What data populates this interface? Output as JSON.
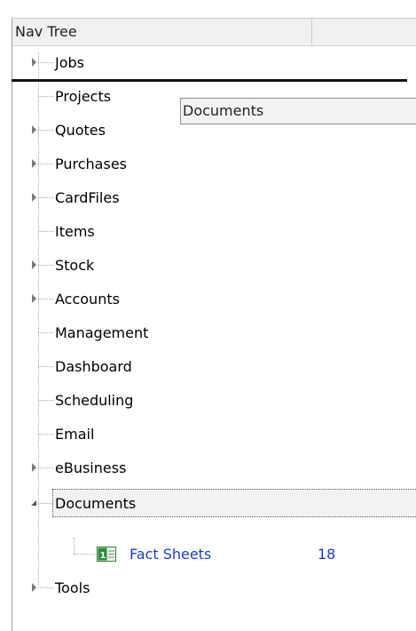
{
  "header": {
    "column1": "Nav Tree",
    "column2": ""
  },
  "tree": {
    "items": [
      {
        "label": "Jobs",
        "expander": true
      },
      {
        "label": "Projects",
        "expander": false
      },
      {
        "label": "Quotes",
        "expander": true
      },
      {
        "label": "Purchases",
        "expander": true
      },
      {
        "label": "CardFiles",
        "expander": true
      },
      {
        "label": "Items",
        "expander": false
      },
      {
        "label": "Stock",
        "expander": true
      },
      {
        "label": "Accounts",
        "expander": true
      },
      {
        "label": "Management",
        "expander": false
      },
      {
        "label": "Dashboard",
        "expander": false
      },
      {
        "label": "Scheduling",
        "expander": false
      },
      {
        "label": "Email",
        "expander": false
      },
      {
        "label": "eBusiness",
        "expander": true
      },
      {
        "label": "Documents",
        "expander": "expanded",
        "selected": true
      },
      {
        "label": "Tools",
        "expander": true
      }
    ],
    "documents_children": [
      {
        "label": "Fact Sheets",
        "count": "18",
        "icon": "spreadsheet-icon"
      }
    ]
  },
  "drag_ghost": {
    "label": "Documents"
  },
  "colors": {
    "child_link": "#1a3fc4",
    "selection_bg": "#f2f2f2"
  }
}
